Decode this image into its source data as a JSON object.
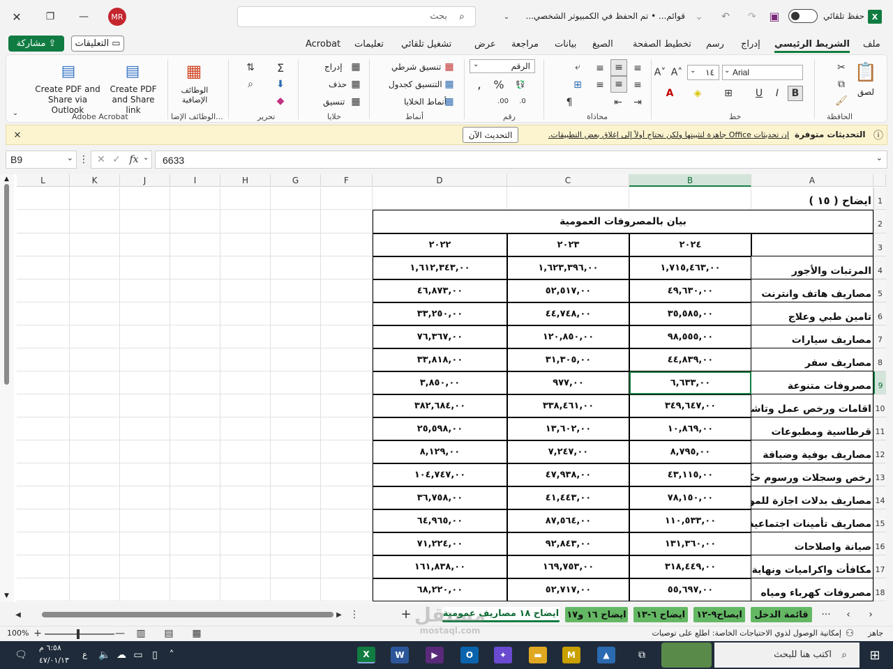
{
  "titlebar": {
    "search_placeholder": "بحث",
    "doc_title": "قوائم... • تم الحفظ في الكمبيوتر الشخصي...",
    "autosave_label": "حفظ تلقائي",
    "user_initials": "MR"
  },
  "tabs": [
    "ملف",
    "الشريط الرئيسي",
    "إدراج",
    "رسم",
    "تخطيط الصفحة",
    "الصيغ",
    "بيانات",
    "مراجعة",
    "عرض",
    "تشغيل تلقائي",
    "تعليمات",
    "Acrobat"
  ],
  "active_tab": "الشريط الرئيسي",
  "comments_label": "التعليقات",
  "share_label": "مشاركة",
  "ribbon": {
    "paste_label": "لصق",
    "clipboard_group": "الحافظة",
    "font_group": "خط",
    "font_name": "Arial",
    "font_size": "١٤",
    "bold": "B",
    "italic": "I",
    "underline": "U",
    "alignment_group": "محاذاة",
    "number_group": "رقم",
    "number_format": "الرقم",
    "styles_group": "أنماط",
    "cond_format": "تنسيق شرطي",
    "format_table": "التنسيق كجدول",
    "cell_styles": "أنماط الخلايا",
    "cells_group": "خلايا",
    "insert": "إدراج",
    "delete": "حذف",
    "format": "تنسيق",
    "editing_group": "تحرير",
    "addins_label": "الوظائف الإضافية",
    "addins_group": "الوظائف الإضا...",
    "acrobat_share_link": "Create PDF and Share link",
    "acrobat_outlook": "Create PDF and Share via Outlook",
    "acrobat_group": "Adobe Acrobat"
  },
  "message": {
    "title": "التحديثات متوفرة",
    "text": "إن تحديثات Office جاهزة لتثبيتها ولكن نحتاج أولاً إلى إغلاق بعض التطبيقات.",
    "button": "التحديث الآن"
  },
  "formula": {
    "name_box": "B9",
    "value": "6633"
  },
  "columns": [
    "A",
    "B",
    "C",
    "D",
    "F",
    "G",
    "H",
    "I",
    "J",
    "K",
    "L"
  ],
  "selected_col": "B",
  "rows": [
    "1",
    "2",
    "3",
    "4",
    "5",
    "6",
    "7",
    "8",
    "9",
    "10",
    "11",
    "12",
    "13",
    "14",
    "15",
    "16",
    "17",
    "18"
  ],
  "selected_row": "9",
  "sheet": {
    "a1": "ايضاح ( ١٥ )",
    "title": "بيان بالمصروفات العمومية",
    "years": [
      "٢٠٢٤",
      "٢٠٢٣",
      "٢٠٢٢"
    ],
    "data": [
      {
        "label": "المرتبات والأجور",
        "b": "١,٧١٥,٤٦٣,٠٠",
        "c": "١,٦٢٣,٣٩٦,٠٠",
        "d": "١,٦١٢,٣٤٣,٠٠"
      },
      {
        "label": "مصاريف هاتف  وانترنت",
        "b": "٤٩,٦٣٠,٠٠",
        "c": "٥٢,٥١٧,٠٠",
        "d": "٤٦,٨٧٣,٠٠"
      },
      {
        "label": "تامين طبي  وعلاج",
        "b": "٣٥,٥٨٥,٠٠",
        "c": "٤٤,٧٤٨,٠٠",
        "d": "٣٣,٢٥٠,٠٠"
      },
      {
        "label": "مصاريف سيارات",
        "b": "٩٨,٥٥٥,٠٠",
        "c": "١٢٠,٨٥٠,٠٠",
        "d": "٧٦,٣٦٧,٠٠"
      },
      {
        "label": "مصاريف سفر",
        "b": "٤٤,٨٣٩,٠٠",
        "c": "٣١,٣٠٥,٠٠",
        "d": "٣٣,٨١٨,٠٠"
      },
      {
        "label": "مصروفات متنوعة",
        "b": "٦,٦٣٣,٠٠",
        "c": "٩٧٧,٠٠",
        "d": "٣,٨٥٠,٠٠"
      },
      {
        "label": "اقامات ورخص عمل وتاشير",
        "b": "٣٤٩,٦٤٧,٠٠",
        "c": "٣٣٨,٤٦١,٠٠",
        "d": "٣٨٢,٦٨٤,٠٠"
      },
      {
        "label": "قرطاسية ومطبوعات",
        "b": "١٠,٨٦٩,٠٠",
        "c": "١٣,٦٠٢,٠٠",
        "d": "٢٥,٥٩٨,٠٠"
      },
      {
        "label": "مصاريف بوفية وضيافة",
        "b": "٨,٧٩٥,٠٠",
        "c": "٧,٢٤٧,٠٠",
        "d": "٨,١٢٩,٠٠"
      },
      {
        "label": "رخص وسجلات ورسوم حكو",
        "b": "٤٣,١١٥,٠٠",
        "c": "٤٧,٩٣٨,٠٠",
        "d": "١٠٤,٧٤٧,٠٠"
      },
      {
        "label": "مصاريف بدلات اجازة للموظ",
        "b": "٧٨,١٥٠,٠٠",
        "c": "٤١,٤٤٣,٠٠",
        "d": "٣٦,٧٥٨,٠٠"
      },
      {
        "label": "مصاريف تأمينات اجتماعية",
        "b": "١١٠,٥٣٣,٠٠",
        "c": "٨٧,٥٦٤,٠٠",
        "d": "٦٤,٩٦٥,٠٠"
      },
      {
        "label": "صيانة واصلاحات",
        "b": "١٣١,٣٦٠,٠٠",
        "c": "٩٢,٨٤٣,٠٠",
        "d": "٧١,٢٢٤,٠٠"
      },
      {
        "label": "مكافأت واكراميات ونهاية خد",
        "b": "٣١٨,٤٤٩,٠٠",
        "c": "١٦٩,٧٥٣,٠٠",
        "d": "١٦١,٨٣٨,٠٠"
      },
      {
        "label": "مصروفات كهرباء ومياه",
        "b": "٥٥,٦٩٧,٠٠",
        "c": "٥٢,٧١٧,٠٠",
        "d": "٦٨,٢٢٠,٠٠"
      }
    ]
  },
  "sheet_tabs": [
    "قائمة الدخل",
    "ايصاح٩-١٢",
    "ايضاح ٦-١٣",
    "ايضاح ١٦ و١٧",
    "ايضاح ١٨ مصاريف عمومية"
  ],
  "active_sheet": "ايضاح ١٨ مصاريف عمومية",
  "status": {
    "ready": "جاهز",
    "accessibility": "إمكانية الوصول لذوي الاحتياجات الخاصة: اطلع على توصيات",
    "zoom": "100%"
  },
  "taskbar": {
    "search_placeholder": "اكتب هنا للبحث",
    "time": "٦:٥٨ م",
    "date": "٤٧/٠١/١٣",
    "lang": "ع"
  },
  "watermark": "mostaql.com"
}
